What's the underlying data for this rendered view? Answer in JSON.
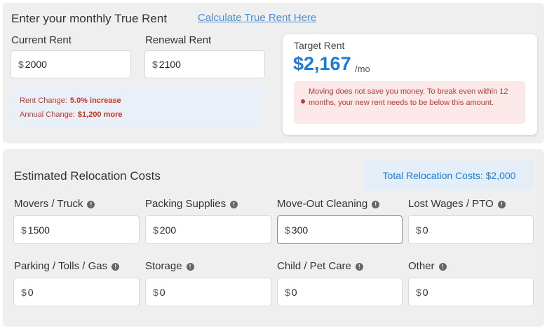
{
  "top": {
    "heading": "Enter your monthly True Rent",
    "calculate_link": "Calculate True Rent Here",
    "current_rent": {
      "label": "Current Rent",
      "currency": "$",
      "value": "2000"
    },
    "renewal_rent": {
      "label": "Renewal Rent",
      "currency": "$",
      "value": "2100"
    },
    "rent_change": {
      "label": "Rent Change:",
      "value": "5.0% increase"
    },
    "annual_change": {
      "label": "Annual Change:",
      "value": "$1,200 more"
    }
  },
  "target": {
    "label": "Target Rent",
    "value": "$2,167",
    "unit": "/mo",
    "alert": "Moving does not save you money. To break even within 12 months, your new rent needs to be below this amount."
  },
  "relocation": {
    "heading": "Estimated Relocation Costs",
    "total": "Total Relocation Costs: $2,000",
    "fields": [
      {
        "label": "Movers / Truck",
        "currency": "$",
        "value": "1500"
      },
      {
        "label": "Packing Supplies",
        "currency": "$",
        "value": "200"
      },
      {
        "label": "Move-Out Cleaning",
        "currency": "$",
        "value": "300"
      },
      {
        "label": "Lost Wages / PTO",
        "currency": "$",
        "value": "0"
      },
      {
        "label": "Parking / Tolls / Gas",
        "currency": "$",
        "value": "0"
      },
      {
        "label": "Storage",
        "currency": "$",
        "value": "0"
      },
      {
        "label": "Child / Pet Care",
        "currency": "$",
        "value": "0"
      },
      {
        "label": "Other",
        "currency": "$",
        "value": "0"
      }
    ]
  },
  "colors": {
    "accent_blue": "#1e7bd6",
    "link_blue": "#4a8fd6",
    "warning_red": "#c0392b",
    "panel_gray": "#efefef"
  }
}
